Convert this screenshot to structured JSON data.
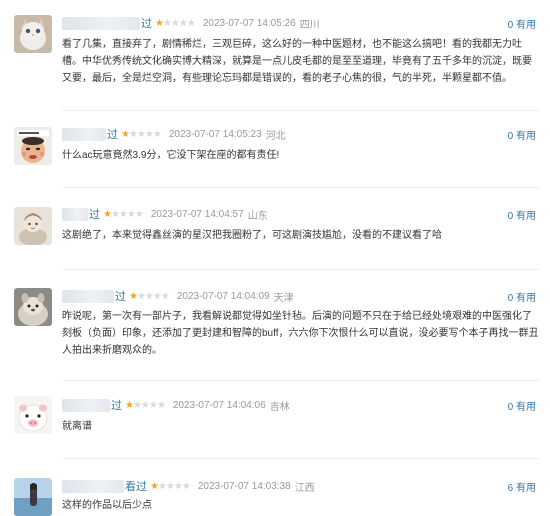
{
  "reviews": [
    {
      "name_suffix": "过",
      "stars": 1,
      "time": "2023-07-07 14:05:26",
      "location": "四川",
      "useful": "0 有用",
      "content": "看了几集，直接弃了，剧情稀烂，三观巨碎，这么好的一种中医题材，也不能这么搞吧！看的我都无力吐槽。中华优秀传统文化确实博大精深，就算是一点儿皮毛都的是至至道理，毕竟有了五千多年的沉淀，既要又要，最后，全是烂空洞，有些理论忘玛都是错误的，看的老子心焦的很，气的半死，半颗星都不值。",
      "avatar": "cat-avatar"
    },
    {
      "name_suffix": "过",
      "stars": 1,
      "time": "2023-07-07 14:05:23",
      "location": "河北",
      "useful": "0 有用",
      "content": "什么ac玩意竟然3.9分，它没下架在座的都有责任!",
      "avatar": "meme-avatar"
    },
    {
      "name_suffix": "过",
      "stars": 1,
      "time": "2023-07-07 14:04:57",
      "location": "山东",
      "useful": "0 有用",
      "content": "这剧绝了，本来觉得鑫丝演的星汉把我圈粉了，可这剧演技尴尬，没看的不建议看了哈",
      "avatar": "doll-avatar"
    },
    {
      "name_suffix": "过",
      "stars": 1,
      "time": "2023-07-07 14:04:09",
      "location": "天津",
      "useful": "0 有用",
      "content": "昨说呢，第一次有一部片子，我看解说都觉得如坐针毡。后演的问题不只在于给已经处境艰难的中医强化了刻板（负面）印象，还添加了更封建和智障的buff，六六你下次恨什么可以直说，没必要写个本子再找一群丑人拍出来折磨观众的。",
      "avatar": "animal-avatar"
    },
    {
      "name_suffix": "过",
      "stars": 1,
      "time": "2023-07-07 14:04:06",
      "location": "吉林",
      "useful": "0 有用",
      "content": "就离谱",
      "avatar": "pig-avatar"
    },
    {
      "name_suffix": "看过",
      "stars": 1,
      "time": "2023-07-07 14:03:38",
      "location": "江西",
      "useful": "6 有用",
      "content": "这样的作品以后少点",
      "avatar": "seaside-avatar"
    }
  ]
}
